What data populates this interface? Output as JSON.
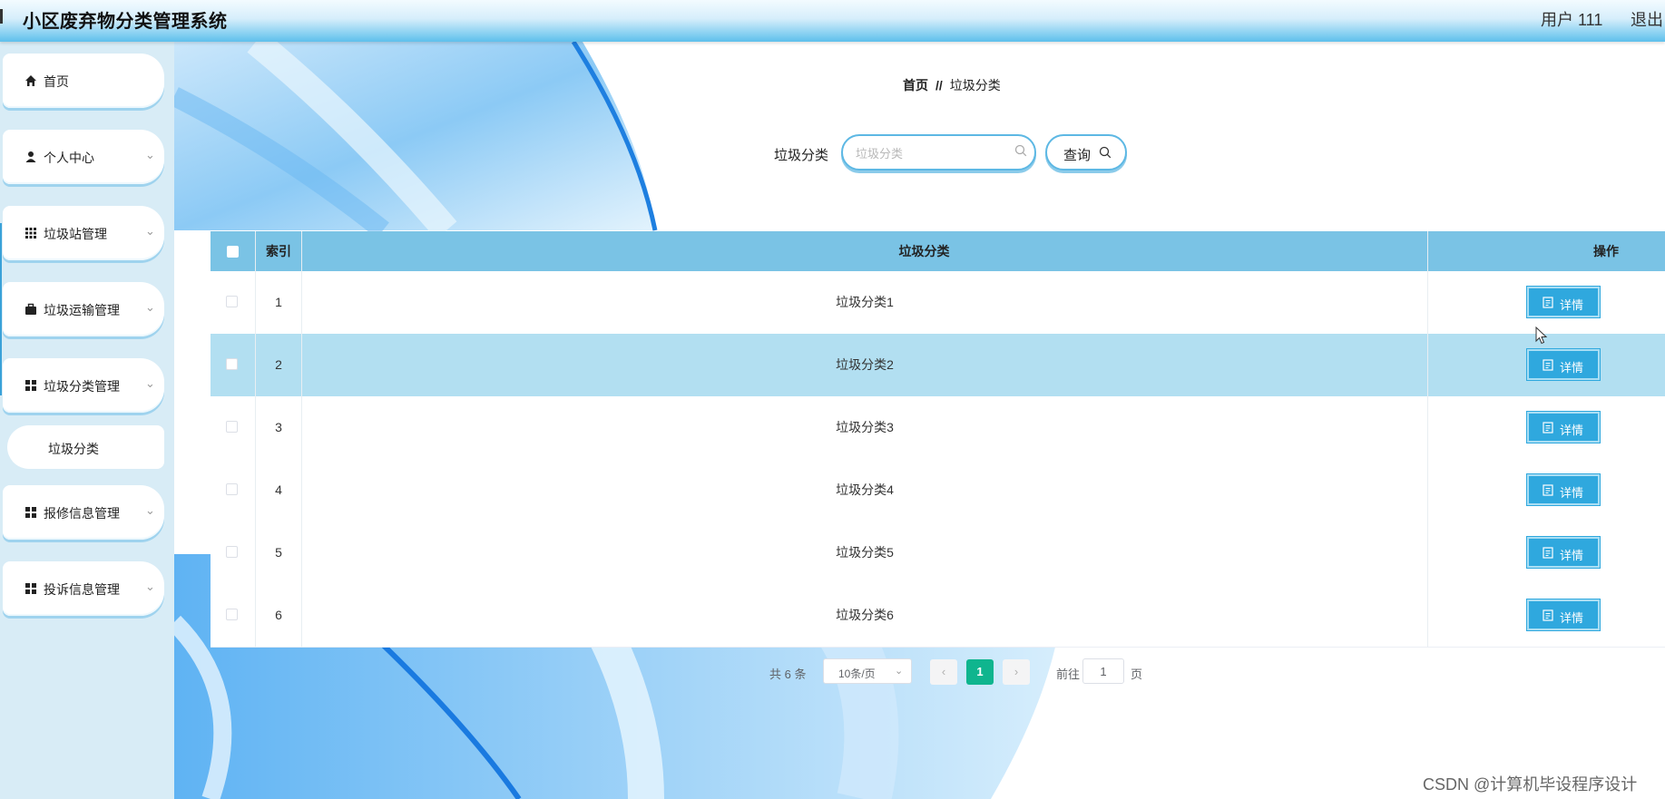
{
  "header": {
    "app_title": "小区废弃物分类管理系统",
    "user_label": "用户 111",
    "logout_label": "退出"
  },
  "sidebar": {
    "items": [
      {
        "label": "首页",
        "icon": "home-icon"
      },
      {
        "label": "个人中心",
        "icon": "user-icon"
      },
      {
        "label": "垃圾站管理",
        "icon": "grid-icon"
      },
      {
        "label": "垃圾运输管理",
        "icon": "briefcase-icon"
      },
      {
        "label": "垃圾分类管理",
        "icon": "apps-icon"
      },
      {
        "label": "报修信息管理",
        "icon": "apps-icon"
      },
      {
        "label": "投诉信息管理",
        "icon": "apps-icon"
      }
    ],
    "subitem": {
      "label": "垃圾分类"
    }
  },
  "breadcrumb": {
    "home": "首页",
    "separator": "//",
    "current": "垃圾分类"
  },
  "search": {
    "label": "垃圾分类",
    "placeholder": "垃圾分类",
    "value": "",
    "button_label": "查询"
  },
  "table": {
    "headers": {
      "index": "索引",
      "category": "垃圾分类",
      "actions": "操作"
    },
    "detail_label": "详情",
    "rows": [
      {
        "index": "1",
        "category": "垃圾分类1"
      },
      {
        "index": "2",
        "category": "垃圾分类2"
      },
      {
        "index": "3",
        "category": "垃圾分类3"
      },
      {
        "index": "4",
        "category": "垃圾分类4"
      },
      {
        "index": "5",
        "category": "垃圾分类5"
      },
      {
        "index": "6",
        "category": "垃圾分类6"
      }
    ]
  },
  "pagination": {
    "total_text": "共 6 条",
    "page_size": "10条/页",
    "current_page": "1",
    "goto_label": "前往",
    "goto_value": "1",
    "goto_suffix": "页"
  },
  "watermark": "CSDN @计算机毕设程序设计",
  "colors": {
    "header_accent": "#5ec0ec",
    "table_header": "#7ac3e5",
    "row_highlight": "#b2dff1",
    "detail_button": "#2fa8de",
    "active_page": "#0fb58e"
  }
}
